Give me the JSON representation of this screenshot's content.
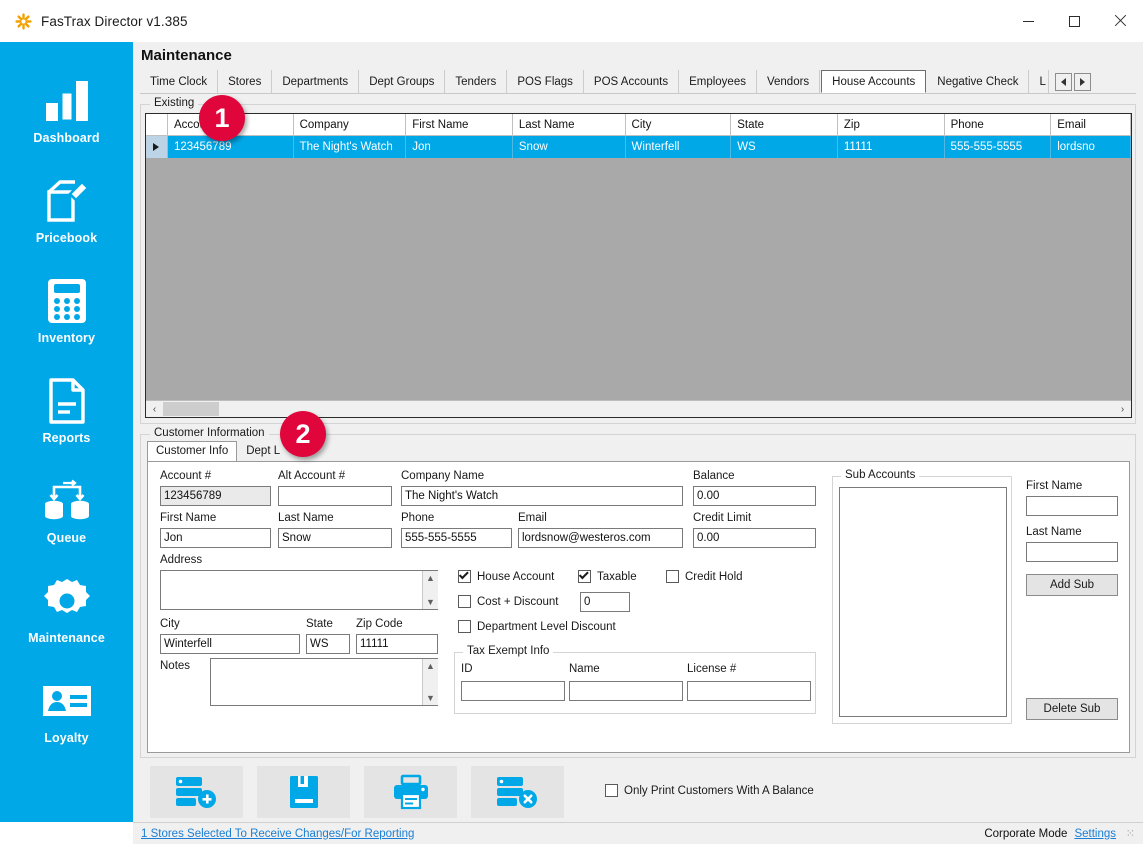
{
  "window": {
    "title": "FasTrax Director v1.385",
    "app_icon": "asterisk-icon",
    "minimize_label": "—",
    "maximize_label": "□",
    "close_label": "×"
  },
  "sidebar": {
    "items": [
      {
        "label": "Dashboard",
        "icon": "bar-chart-icon"
      },
      {
        "label": "Pricebook",
        "icon": "price-tag-icon"
      },
      {
        "label": "Inventory",
        "icon": "calculator-icon"
      },
      {
        "label": "Reports",
        "icon": "document-icon"
      },
      {
        "label": "Queue",
        "icon": "database-sync-icon"
      },
      {
        "label": "Maintenance",
        "icon": "gear-icon"
      },
      {
        "label": "Loyalty",
        "icon": "id-card-icon"
      }
    ]
  },
  "header": {
    "title": "Maintenance"
  },
  "tabs": {
    "items": [
      "Time Clock",
      "Stores",
      "Departments",
      "Dept Groups",
      "Tenders",
      "POS Flags",
      "POS Accounts",
      "Employees",
      "Vendors",
      "House Accounts",
      "Negative Check",
      "L"
    ],
    "selected": "House Accounts",
    "scroll_left_label": "◀",
    "scroll_right_label": "▶"
  },
  "existing": {
    "group_label": "Existing",
    "columns": [
      "",
      "Account #",
      "Company",
      "First Name",
      "Last Name",
      "City",
      "State",
      "Zip",
      "Phone",
      "Email"
    ],
    "rows": [
      {
        "selector": "▶",
        "account": "123456789",
        "company": "The Night's Watch",
        "first_name": "Jon",
        "last_name": "Snow",
        "city": "Winterfell",
        "state": "WS",
        "zip": "11111",
        "phone": "555-555-5555",
        "email": "lordsno"
      }
    ],
    "hscroll_left": "‹",
    "hscroll_right": "›"
  },
  "customer_information": {
    "group_label": "Customer Information",
    "tabs": [
      {
        "label": "Customer Info",
        "selected": true
      },
      {
        "label": "Dept L",
        "selected": false
      }
    ],
    "fields": {
      "account_label": "Account #",
      "account_value": "123456789",
      "alt_account_label": "Alt Account #",
      "alt_account_value": "",
      "company_label": "Company Name",
      "company_value": "The Night's Watch",
      "balance_label": "Balance",
      "balance_value": "0.00",
      "first_name_label": "First Name",
      "first_name_value": "Jon",
      "last_name_label": "Last Name",
      "last_name_value": "Snow",
      "phone_label": "Phone",
      "phone_value": "555-555-5555",
      "email_label": "Email",
      "email_value": "lordsnow@westeros.com",
      "credit_limit_label": "Credit Limit",
      "credit_limit_value": "0.00",
      "address_label": "Address",
      "address_value": "",
      "city_label": "City",
      "city_value": "Winterfell",
      "state_label": "State",
      "state_value": "WS",
      "zip_label": "Zip Code",
      "zip_value": "11111",
      "notes_label": "Notes",
      "notes_value": ""
    },
    "checkboxes": {
      "house_account_label": "House Account",
      "house_account_checked": true,
      "taxable_label": "Taxable",
      "taxable_checked": true,
      "credit_hold_label": "Credit Hold",
      "credit_hold_checked": false,
      "cost_discount_label": "Cost + Discount",
      "cost_discount_checked": false,
      "cost_discount_value": "0",
      "dept_level_discount_label": "Department Level Discount",
      "dept_level_discount_checked": false
    },
    "tax_exempt": {
      "group_label": "Tax Exempt Info",
      "id_label": "ID",
      "id_value": "",
      "name_label": "Name",
      "name_value": "",
      "license_label": "License #",
      "license_value": ""
    },
    "sub_accounts": {
      "group_label": "Sub Accounts",
      "items": [],
      "first_name_label": "First Name",
      "first_name_value": "",
      "last_name_label": "Last Name",
      "last_name_value": "",
      "add_button": "Add Sub",
      "delete_button": "Delete Sub"
    }
  },
  "toolbar": {
    "buttons": [
      {
        "name": "add-record-button",
        "icon": "database-add-icon"
      },
      {
        "name": "save-button",
        "icon": "floppy-save-icon"
      },
      {
        "name": "print-button",
        "icon": "printer-icon"
      },
      {
        "name": "delete-record-button",
        "icon": "database-delete-icon"
      }
    ],
    "only_print_label": "Only Print Customers With A  Balance",
    "only_print_checked": false
  },
  "statusbar": {
    "stores_link": "1 Stores Selected To Receive Changes/For Reporting",
    "mode": "Corporate Mode",
    "settings_link": "Settings",
    "grip": "⁙"
  },
  "badges": [
    {
      "number": "1"
    },
    {
      "number": "2"
    }
  ],
  "colors": {
    "accent": "#00a8e8",
    "badge": "#e0063c",
    "grid_empty": "#a9a9a9",
    "link": "#1a7fd4"
  }
}
